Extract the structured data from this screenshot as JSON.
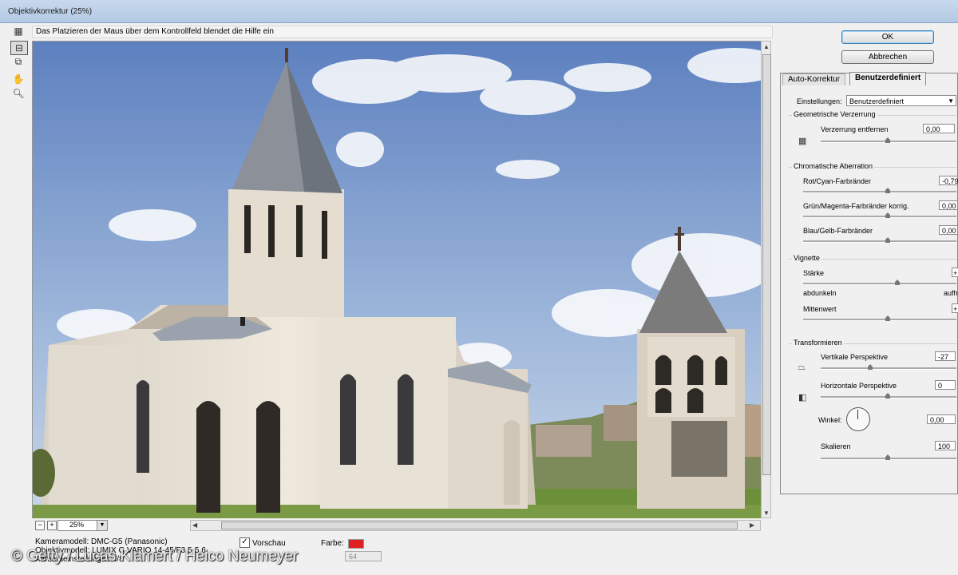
{
  "window": {
    "title": "Objektivkorrektur (25%)"
  },
  "hint": "Das Platzieren der Maus über dem Kontrollfeld blendet die Hilfe ein",
  "toolbar": {
    "tools": [
      "distortion-tool",
      "straighten-tool",
      "grid-tool",
      "hand-tool",
      "zoom-tool"
    ]
  },
  "zoom": {
    "minus": "−",
    "plus": "+",
    "value": "25%"
  },
  "info": {
    "kameramodell": "Kameramodell: DMC-G5 (Panasonic)",
    "objektivmodell": "Objektivmodell: LUMIX G VARIO 14-45/F3.5-5.6",
    "kamera_einstellungen": "Kameraeinstellungen: f/8",
    "vorschau": "Vorschau",
    "vorschau_checked": true,
    "farbe_label": "Farbe:",
    "farbe_color": "#e02020",
    "grid_value": "64"
  },
  "buttons": {
    "ok": "OK",
    "cancel": "Abbrechen"
  },
  "tabs": {
    "auto": "Auto-Korrektur",
    "custom": "Benutzerdefiniert"
  },
  "settings": {
    "label": "Einstellungen:",
    "value": "Benutzerdefiniert"
  },
  "geometric": {
    "title": "Geometrische Verzerrung",
    "remove_label": "Verzerrung entfernen",
    "remove_value": "0,00"
  },
  "chromatic": {
    "title": "Chromatische Aberration",
    "red_cyan_label": "Rot/Cyan-Farbränder",
    "red_cyan_value": "-0,79",
    "green_magenta_label": "Grün/Magenta-Farbränder korrig.",
    "green_magenta_value": "0,00",
    "blue_yellow_label": "Blau/Gelb-Farbränder",
    "blue_yellow_value": "0,00"
  },
  "vignette": {
    "title": "Vignette",
    "strength_label": "Stärke",
    "strength_value": "+",
    "darken_label": "abdunkeln",
    "lighten_label": "aufh",
    "midpoint_label": "Mittenwert",
    "midpoint_value": "+"
  },
  "transform": {
    "title": "Transformieren",
    "vertical_label": "Vertikale Perspektive",
    "vertical_value": "-27",
    "horizontal_label": "Horizontale Perspektive",
    "horizontal_value": "0",
    "angle_label": "Winkel:",
    "angle_value": "0,00",
    "scale_label": "Skalieren",
    "scale_value": "100"
  },
  "watermark": "© Getty / Lucas Klamert / Heico Neumeyer"
}
